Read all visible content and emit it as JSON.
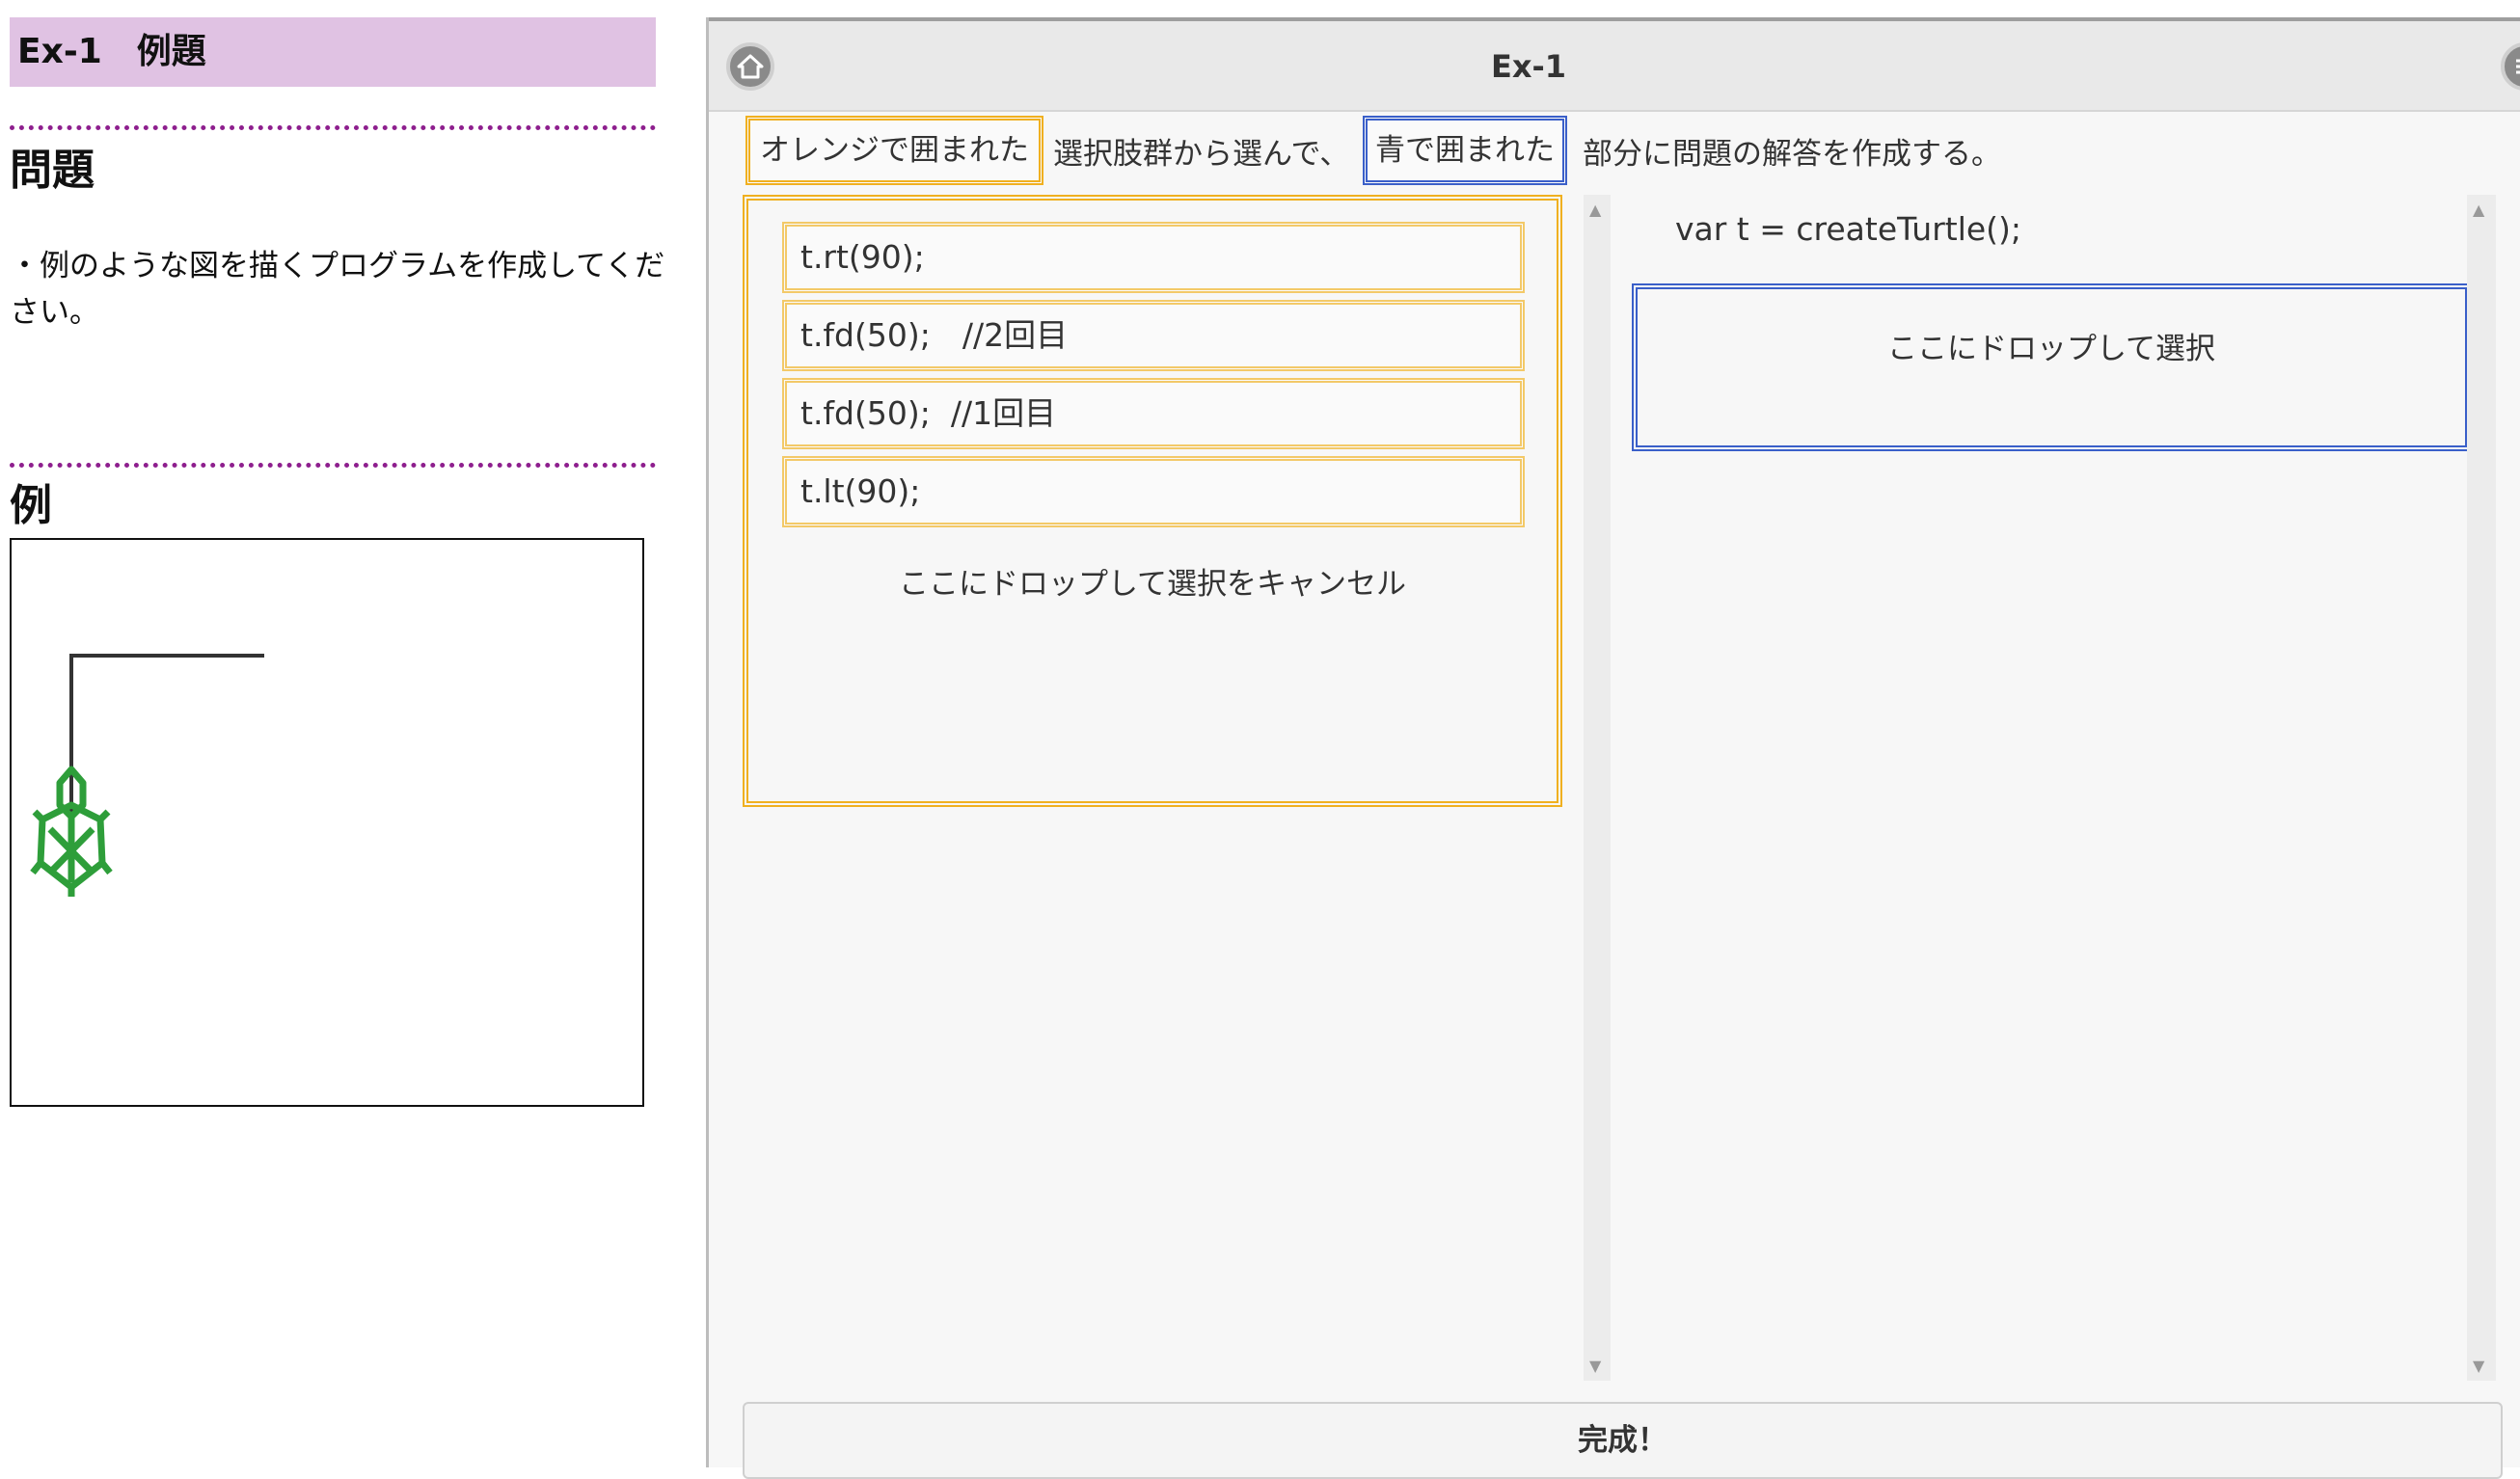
{
  "left": {
    "title": "Ex-1　例題",
    "problem_heading": "問題",
    "problem_text": "・例のような図を描くプログラムを作成してください。",
    "example_heading": "例"
  },
  "app": {
    "title": "Ex-1",
    "home_icon": "home-icon",
    "menu_icon": "menu-icon",
    "instructions": {
      "orange_tag": "オレンジで囲まれた",
      "middle_text": "選択肢群から選んで、",
      "blue_tag": "青で囲まれた",
      "end_text": "部分に問題の解答を作成する。"
    },
    "choices": [
      "t.rt(90);",
      "t.fd(50);　//2回目",
      "t.fd(50);  //1回目",
      "t.lt(90);"
    ],
    "cancel_label": "ここにドロップして選択をキャンセル",
    "code_line": "var t = createTurtle();",
    "drop_label": "ここにドロップして選択",
    "done_label": "完成！"
  },
  "colors": {
    "title_bg": "#e0c2e3",
    "dotted_rule": "#8e1f8e",
    "orange_border": "#f0b020",
    "blue_border": "#3a5fc9",
    "turtle_green": "#2e9e3a"
  }
}
